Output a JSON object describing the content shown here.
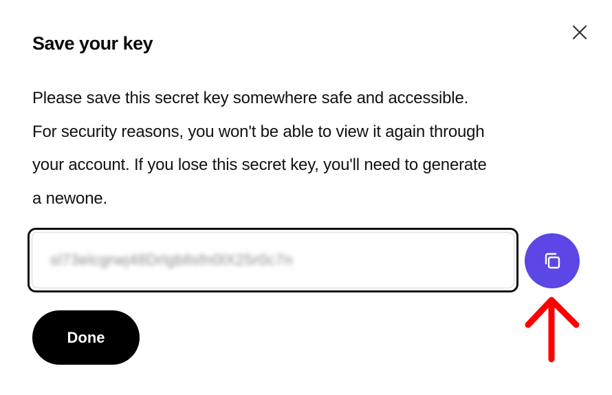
{
  "dialog": {
    "title": "Save your key",
    "message_lines": [
      "Please save this secret key somewhere safe and accessible.",
      "For security reasons, you won't be able to view it again through",
      "your account. If you lose this secret key, you'll need to generate",
      "a newone."
    ],
    "key_value": "sl73elcgrwj48Drlgbllsfn0lX25r0c7n",
    "done_label": "Done"
  },
  "icons": {
    "close": "close-icon",
    "copy": "copy-icon",
    "annotation": "red-arrow-up-icon"
  },
  "colors": {
    "copy_button": "#5b47e6",
    "done_button": "#000000",
    "annotation_arrow": "#ff0000"
  }
}
